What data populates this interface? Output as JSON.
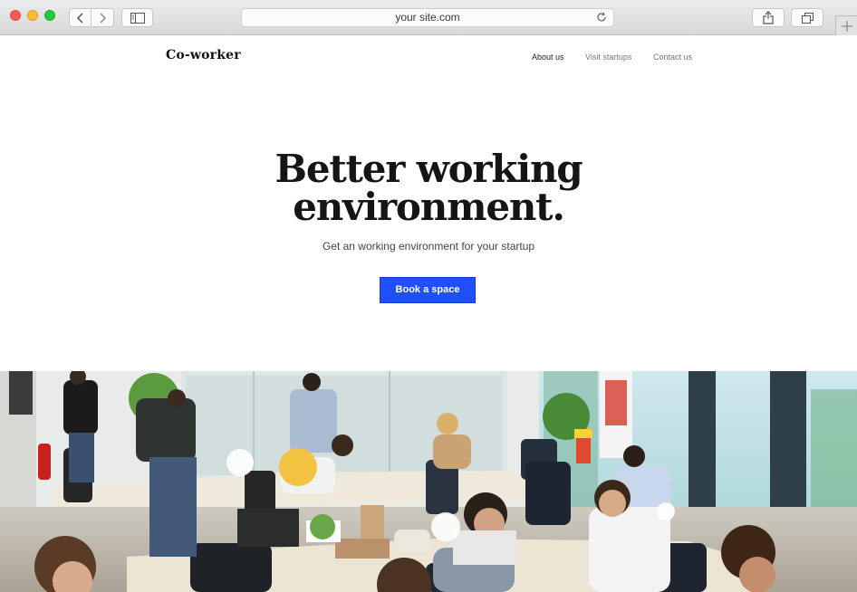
{
  "browser": {
    "url": "your site.com",
    "icons": {
      "back": "chevron-left-icon",
      "forward": "chevron-right-icon",
      "sidebar": "sidebar-icon",
      "reload": "reload-icon",
      "share": "share-icon",
      "tabs": "tabs-icon",
      "new_tab": "plus-icon"
    }
  },
  "site": {
    "brand": "Co-worker",
    "nav": [
      {
        "label": "About us",
        "active": true
      },
      {
        "label": "Visit startups",
        "active": false
      },
      {
        "label": "Contact us",
        "active": false
      }
    ]
  },
  "hero": {
    "title_line1": "Better working",
    "title_line2": "environment.",
    "subtitle": "Get an working environment for your startup",
    "cta": "Book a space"
  },
  "colors": {
    "cta_background": "#1f4fff",
    "text_dark": "#151515",
    "nav_muted": "#777777"
  }
}
